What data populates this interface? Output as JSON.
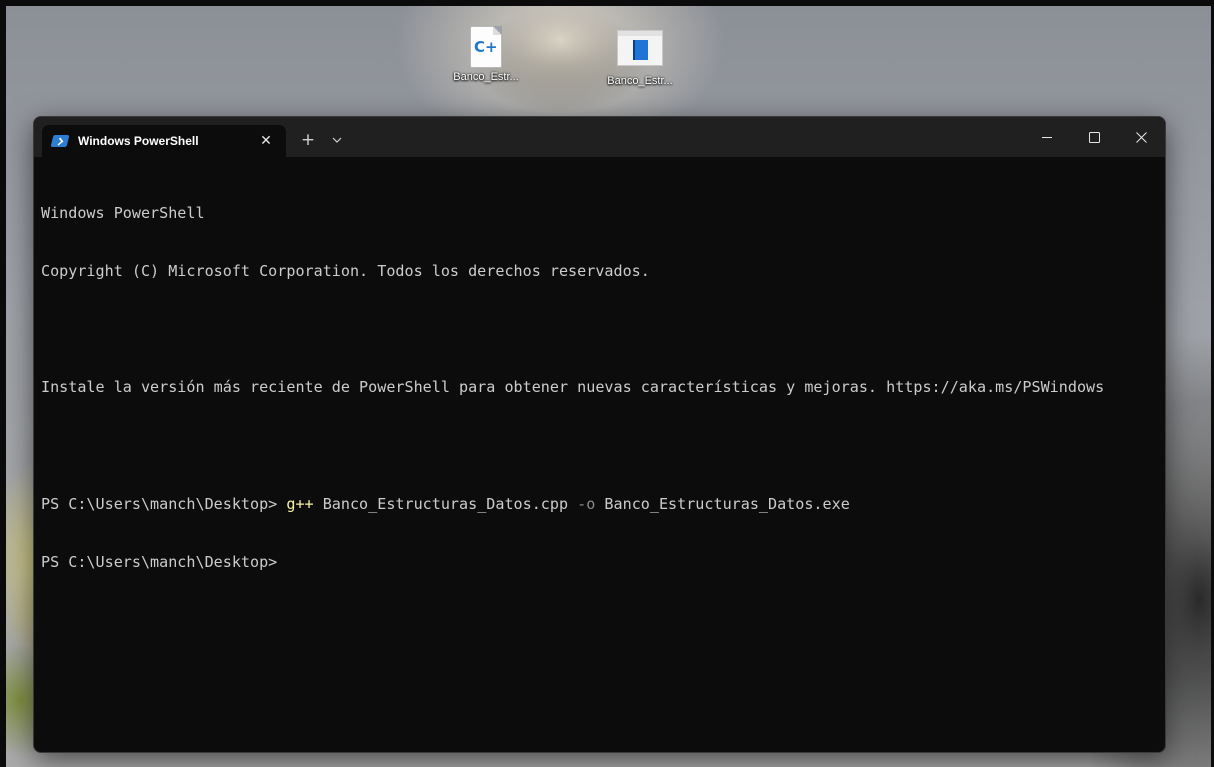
{
  "desktop": {
    "icons": [
      {
        "label": "Banco_Estr...",
        "icon": "cpp-file-icon"
      },
      {
        "label": "Banco_Estr...",
        "icon": "exe-file-icon"
      }
    ]
  },
  "window": {
    "tab": {
      "title": "Windows PowerShell",
      "icon": "powershell-icon",
      "close_glyph": "✕"
    },
    "new_tab_glyph": "+",
    "controls": [
      "minimize-icon",
      "maximize-icon",
      "close-icon"
    ]
  },
  "console": {
    "lines": [
      "Windows PowerShell",
      "Copyright (C) Microsoft Corporation. Todos los derechos reservados.",
      "",
      "Instale la versión más reciente de PowerShell para obtener nuevas características y mejoras. https://aka.ms/PSWindows",
      ""
    ],
    "command_line": {
      "prompt": "PS C:\\Users\\manch\\Desktop> ",
      "command": "g++",
      "arg1": " Banco_Estructuras_Datos.cpp ",
      "flag": "-o",
      "arg2": " Banco_Estructuras_Datos.exe"
    },
    "current_prompt": "PS C:\\Users\\manch\\Desktop>"
  },
  "colors": {
    "console_bg": "#0c0c0c",
    "console_text": "#cccccc",
    "command_text": "#f9f1a5",
    "parameter_text": "#8a8a8a",
    "titlebar_bg": "#202020",
    "powershell_accent": "#2d7dd2"
  }
}
